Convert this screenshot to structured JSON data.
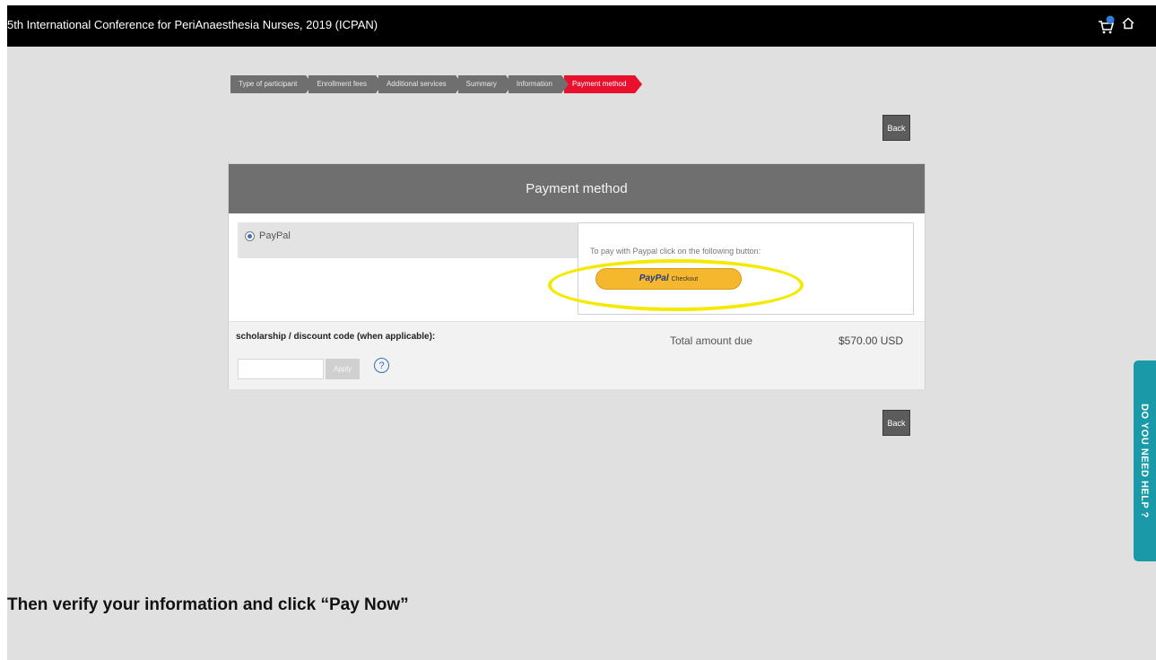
{
  "header": {
    "title": "5th International Conference for PeriAnaesthesia Nurses, 2019 (ICPAN)",
    "cart_icon": "cart-icon",
    "home_icon": "home-icon"
  },
  "steps": [
    {
      "label": "Type of participant",
      "active": false
    },
    {
      "label": "Enrollment fees",
      "active": false
    },
    {
      "label": "Additional services",
      "active": false
    },
    {
      "label": "Summary",
      "active": false
    },
    {
      "label": "Information",
      "active": false
    },
    {
      "label": "Payment method",
      "active": true
    }
  ],
  "buttons": {
    "back_top": "Back",
    "back_bottom": "Back"
  },
  "payment": {
    "heading": "Payment method",
    "option_label": "PayPal",
    "paypal_hint": "To pay with Paypal click on the following button:",
    "paypal_button_logo": "PayPal",
    "paypal_button_sub": "Checkout"
  },
  "discount": {
    "label": "scholarship / discount code (when applicable):",
    "input_value": "",
    "apply_label": "Apply",
    "help_symbol": "?"
  },
  "total": {
    "label": "Total amount due",
    "value": "$570.00 USD"
  },
  "help_tab": {
    "label": "DO YOU NEED HELP ?"
  },
  "caption": "Then verify your information and click “Pay Now”",
  "colors": {
    "active_step": "#e8102c",
    "inactive_step": "#6f6f6f",
    "panel_header": "#6f6f6f",
    "paypal_button": "#f5b72d",
    "highlight": "#f3ea00",
    "help_tab": "#1a9aa8"
  }
}
